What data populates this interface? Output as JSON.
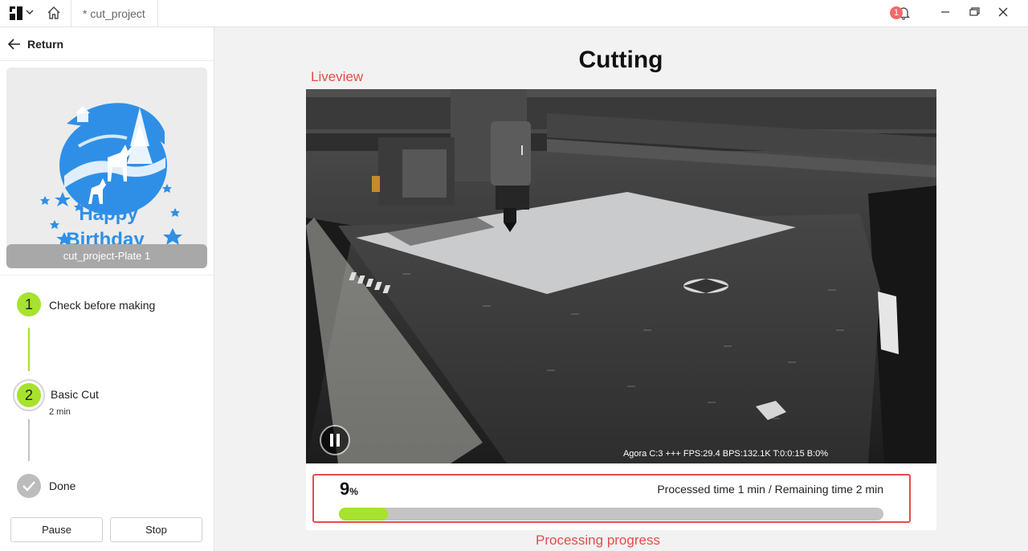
{
  "titlebar": {
    "tab_title": "* cut_project",
    "notification_count": "1"
  },
  "sidebar": {
    "return_label": "Return",
    "plate_label": "cut_project-Plate 1",
    "preview_text": [
      "Happy",
      "Birthday"
    ],
    "steps": [
      {
        "number": "1",
        "label": "Check before making",
        "state": "complete"
      },
      {
        "number": "2",
        "label": "Basic Cut",
        "sub": "2 min",
        "state": "active"
      },
      {
        "label": "Done",
        "state": "pending"
      }
    ],
    "pause_label": "Pause",
    "stop_label": "Stop"
  },
  "main": {
    "title": "Cutting",
    "liveview_annotation": "Liveview",
    "video_stats": "Agora C:3 +++ FPS:29.4 BPS:132.1K T:0:0:15 B:0%",
    "progress": {
      "percent_value": "9",
      "percent_sign": "%",
      "fraction": 0.09,
      "time_text": "Processed time 1 min / Remaining time 2 min"
    },
    "progress_annotation": "Processing progress"
  },
  "colors": {
    "accent_green": "#a6e22e",
    "annotation_red": "#e84b4b",
    "design_blue": "#2f8fe6"
  },
  "icons": [
    "app-logo-icon",
    "chevron-down-icon",
    "home-icon",
    "bell-icon",
    "minimize-icon",
    "maximize-icon",
    "close-icon",
    "arrow-left-icon",
    "check-icon",
    "pause-icon"
  ]
}
